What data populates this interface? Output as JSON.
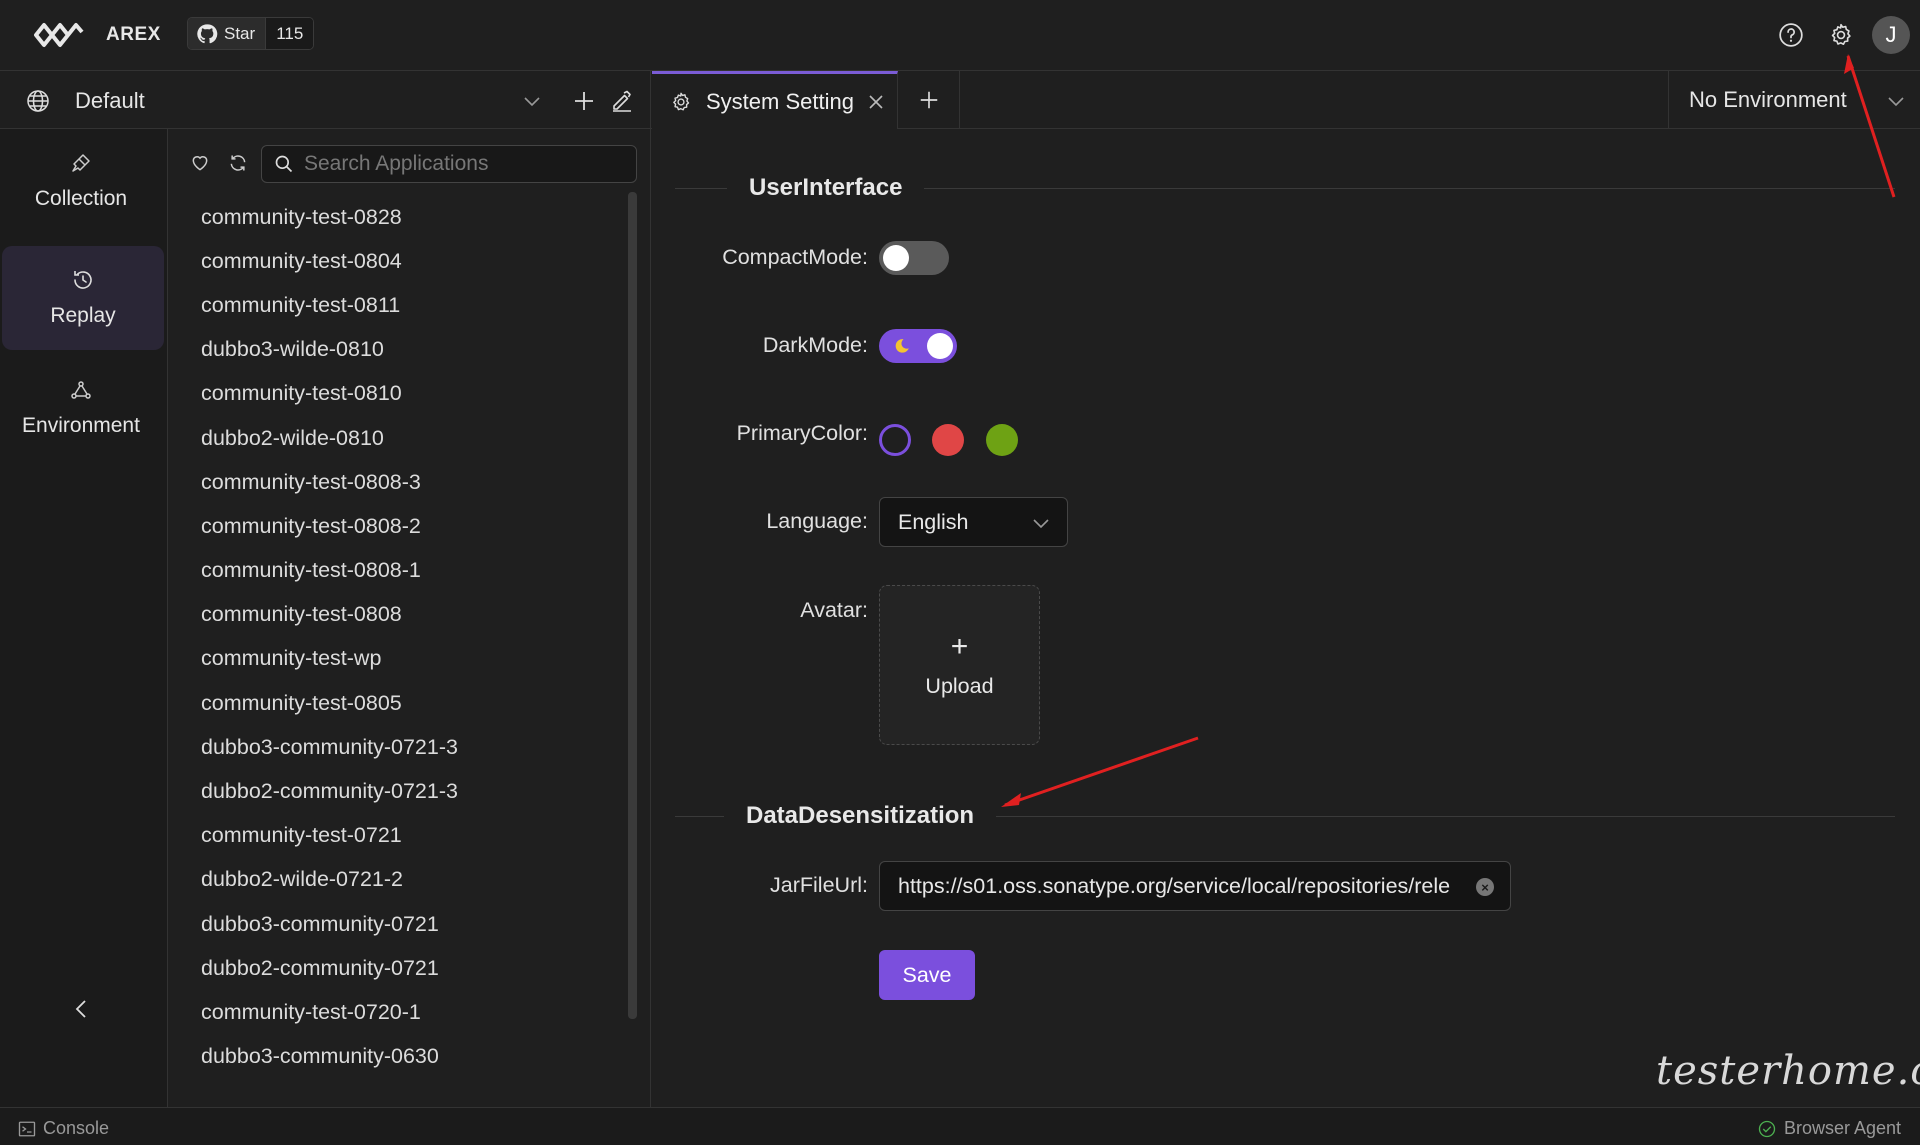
{
  "header": {
    "brand": "AREX",
    "github_star_label": "Star",
    "github_star_count": "115",
    "avatar_initial": "J"
  },
  "workspace": {
    "name": "Default"
  },
  "leftnav": {
    "items": [
      {
        "label": "Collection",
        "icon": "collection-icon"
      },
      {
        "label": "Replay",
        "icon": "replay-icon",
        "active": true
      },
      {
        "label": "Environment",
        "icon": "environment-icon"
      }
    ]
  },
  "applist": {
    "search_placeholder": "Search Applications",
    "items": [
      "community-test-0828",
      "community-test-0804",
      "community-test-0811",
      "dubbo3-wilde-0810",
      "community-test-0810",
      "dubbo2-wilde-0810",
      "community-test-0808-3",
      "community-test-0808-2",
      "community-test-0808-1",
      "community-test-0808",
      "community-test-wp",
      "community-test-0805",
      "dubbo3-community-0721-3",
      "dubbo2-community-0721-3",
      "community-test-0721",
      "dubbo2-wilde-0721-2",
      "dubbo3-community-0721",
      "dubbo2-community-0721",
      "community-test-0720-1",
      "dubbo3-community-0630"
    ]
  },
  "tabs": {
    "active_label": "System Setting",
    "environment": "No Environment"
  },
  "settings": {
    "section_ui": "UserInterface",
    "compact_label": "CompactMode",
    "compact_on": false,
    "dark_label": "DarkMode",
    "dark_on": true,
    "primary_label": "PrimaryColor",
    "colors": [
      "#7b4fdd",
      "#e04646",
      "#6ea214"
    ],
    "language_label": "Language",
    "language_value": "English",
    "avatar_label": "Avatar",
    "upload_label": "Upload",
    "section_data": "DataDesensitization",
    "jar_label": "JarFileUrl",
    "jar_value": "https://s01.oss.sonatype.org/service/local/repositories/rele",
    "save_label": "Save"
  },
  "footer": {
    "console": "Console",
    "agent": "Browser Agent",
    "watermark": "testerhome.com"
  }
}
